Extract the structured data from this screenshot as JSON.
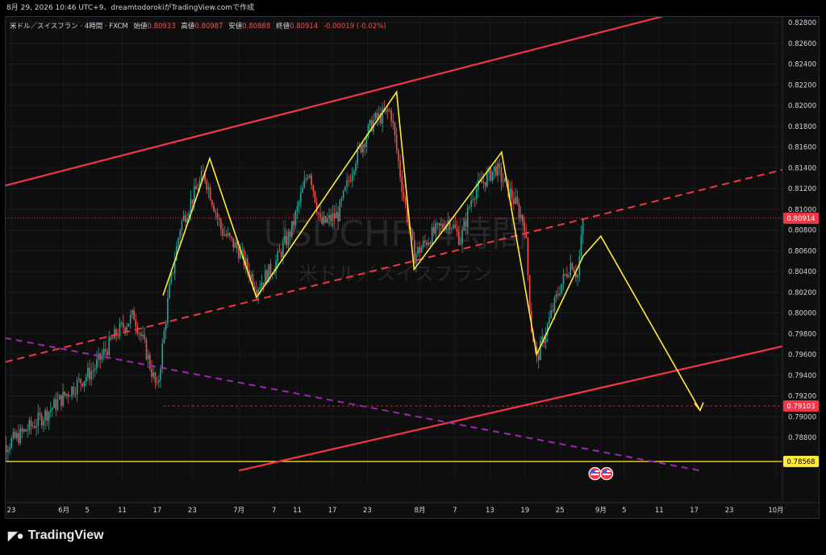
{
  "header_text": "8月 29, 2026 10:46 UTC+9、dreamtodorokiがTradingView.comで作成",
  "legend": {
    "symbol": "米ドル／スイスフラン · 4時間 · FXCM",
    "open_label": "始値",
    "open": "0.80933",
    "high_label": "高値",
    "high": "0.80987",
    "low_label": "安値",
    "low": "0.80888",
    "close_label": "終値",
    "close": "0.80914",
    "change": "-0.00019 (-0.02%)"
  },
  "watermark": {
    "line1": "USDCHF, 4時間",
    "line2": "米ドル／スイスフラン"
  },
  "brand": "TradingView",
  "colors": {
    "channel": "#f23645",
    "zigzag": "#ffeb3b",
    "trend": "#9c27b0",
    "up": "#26a69a",
    "down": "#ef5350",
    "bg": "#0e0e0e"
  },
  "chart_data": {
    "type": "candlestick",
    "title": "",
    "ylim": [
      0.7848,
      0.8288
    ],
    "x_tick_labels": [
      "23",
      "6月",
      "5",
      "11",
      "17",
      "23",
      "7月",
      "7",
      "11",
      "17",
      "23",
      "8月",
      "7",
      "13",
      "19",
      "25",
      "9月",
      "5",
      "11",
      "17",
      "23",
      "10月"
    ],
    "y_tick_labels": [
      "0.82800",
      "0.82600",
      "0.82400",
      "0.82200",
      "0.82000",
      "0.81800",
      "0.81600",
      "0.81400",
      "0.81200",
      "0.81000",
      "0.80800",
      "0.80600",
      "0.80400",
      "0.80200",
      "0.80000",
      "0.79800",
      "0.79600",
      "0.79400",
      "0.79200",
      "0.79000",
      "0.78800"
    ],
    "price_labels": [
      {
        "value": "0.80914",
        "color": "#f23645"
      },
      {
        "value": "0.79103",
        "color": "#f23645"
      },
      {
        "value": "0.78568",
        "color": "#ffeb3b"
      }
    ],
    "price_path": [
      {
        "date": "05-20",
        "price": 0.7865
      },
      {
        "date": "05-24",
        "price": 0.788
      },
      {
        "date": "05-28",
        "price": 0.7898
      },
      {
        "date": "06-02",
        "price": 0.7925
      },
      {
        "date": "06-06",
        "price": 0.7945
      },
      {
        "date": "06-10",
        "price": 0.798
      },
      {
        "date": "06-13",
        "price": 0.7998
      },
      {
        "date": "06-15",
        "price": 0.7965
      },
      {
        "date": "06-17",
        "price": 0.7925
      },
      {
        "date": "06-19",
        "price": 0.802
      },
      {
        "date": "06-21",
        "price": 0.8085
      },
      {
        "date": "06-25",
        "price": 0.8135
      },
      {
        "date": "06-28",
        "price": 0.808
      },
      {
        "date": "07-01",
        "price": 0.806
      },
      {
        "date": "07-04",
        "price": 0.8025
      },
      {
        "date": "07-07",
        "price": 0.8045
      },
      {
        "date": "07-10",
        "price": 0.808
      },
      {
        "date": "07-13",
        "price": 0.814
      },
      {
        "date": "07-15",
        "price": 0.8085
      },
      {
        "date": "07-18",
        "price": 0.8095
      },
      {
        "date": "07-21",
        "price": 0.815
      },
      {
        "date": "07-24",
        "price": 0.8185
      },
      {
        "date": "07-27",
        "price": 0.8195
      },
      {
        "date": "07-29",
        "price": 0.812
      },
      {
        "date": "07-31",
        "price": 0.8055
      },
      {
        "date": "08-03",
        "price": 0.8075
      },
      {
        "date": "08-06",
        "price": 0.809
      },
      {
        "date": "08-08",
        "price": 0.807
      },
      {
        "date": "08-10",
        "price": 0.8115
      },
      {
        "date": "08-14",
        "price": 0.814
      },
      {
        "date": "08-17",
        "price": 0.811
      },
      {
        "date": "08-19",
        "price": 0.8085
      },
      {
        "date": "08-20",
        "price": 0.799
      },
      {
        "date": "08-21",
        "price": 0.7955
      },
      {
        "date": "08-23",
        "price": 0.799
      },
      {
        "date": "08-25",
        "price": 0.8025
      },
      {
        "date": "08-27",
        "price": 0.805
      },
      {
        "date": "08-28",
        "price": 0.8035
      },
      {
        "date": "08-29",
        "price": 0.8091
      }
    ],
    "zigzag_points": [
      {
        "date": "06-18",
        "price": 0.8017
      },
      {
        "date": "06-26",
        "price": 0.8149
      },
      {
        "date": "07-04",
        "price": 0.8015
      },
      {
        "date": "07-28",
        "price": 0.8213
      },
      {
        "date": "07-31",
        "price": 0.8042
      },
      {
        "date": "08-15",
        "price": 0.8155
      },
      {
        "date": "08-21",
        "price": 0.796
      },
      {
        "date": "08-29",
        "price": 0.8055
      },
      {
        "date": "09-01",
        "price": 0.8074
      },
      {
        "date": "09-18",
        "price": 0.7906
      }
    ],
    "channel_upper": [
      {
        "date": "05-20",
        "price": 0.812
      },
      {
        "date": "09-13",
        "price": 0.8288
      }
    ],
    "channel_mid": [
      {
        "date": "05-20",
        "price": 0.795
      },
      {
        "date": "10-10",
        "price": 0.8149
      }
    ],
    "channel_lower": [
      {
        "date": "07-01",
        "price": 0.7848
      },
      {
        "date": "10-10",
        "price": 0.7978
      }
    ],
    "trend_dashed": [
      {
        "date": "05-20",
        "price": 0.7978
      },
      {
        "date": "09-18",
        "price": 0.7848
      }
    ],
    "horizontal_levels": [
      {
        "price": 0.80914,
        "style": "dotted",
        "color": "#f23645"
      },
      {
        "price": 0.79103,
        "style": "dashed",
        "color": "#f23645"
      },
      {
        "price": 0.78568,
        "style": "solid",
        "color": "#ffeb3b"
      }
    ],
    "events": [
      {
        "date": "08-31",
        "icon": "us-flag-icon"
      },
      {
        "date": "09-02",
        "icon": "us-flag-icon"
      }
    ]
  }
}
